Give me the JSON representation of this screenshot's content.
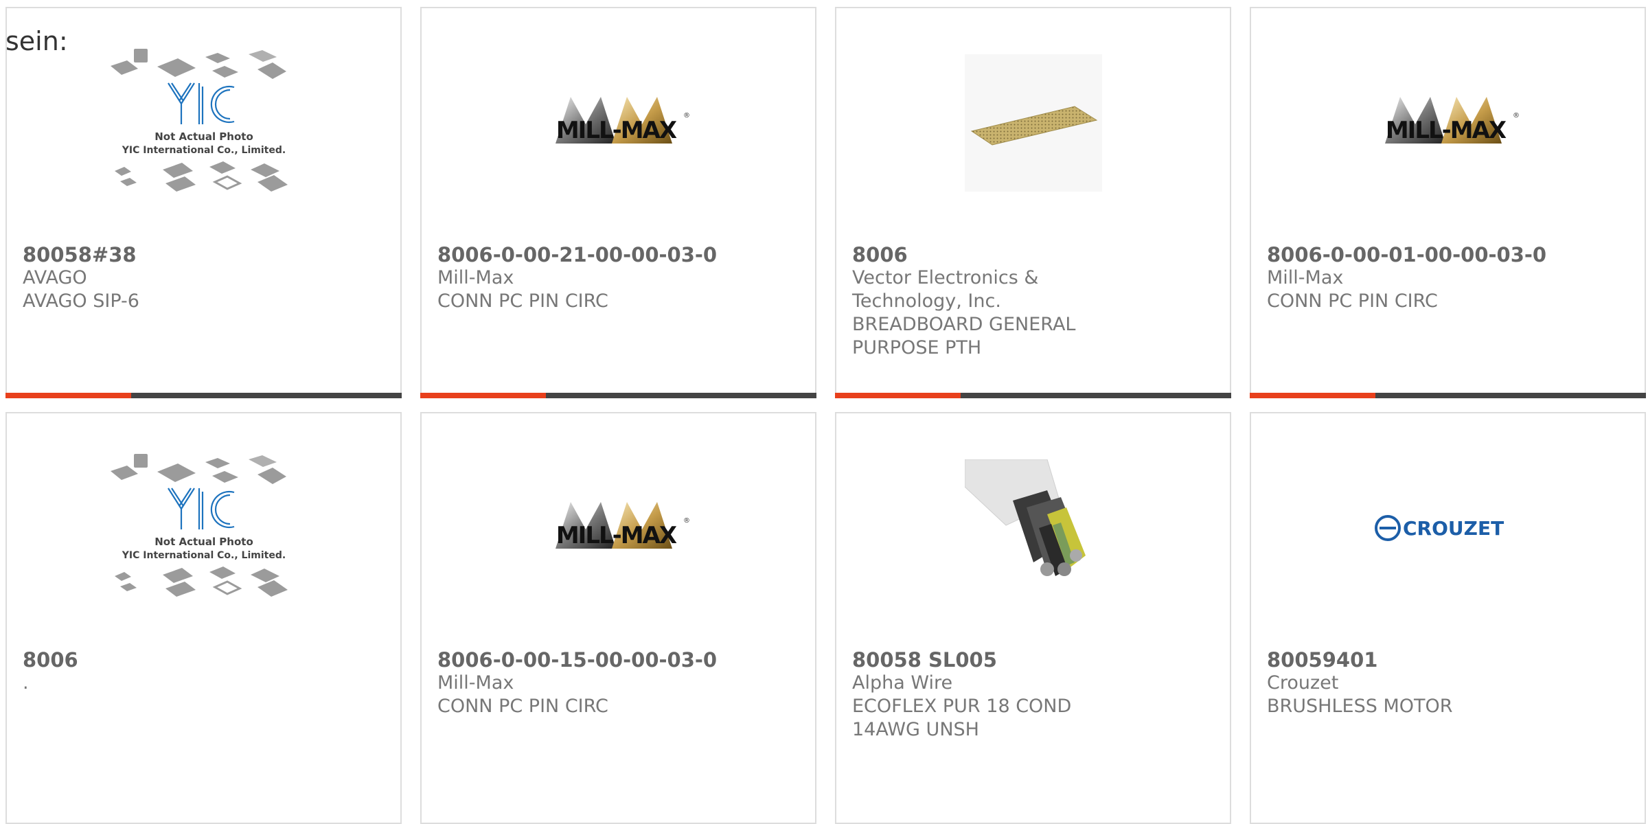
{
  "lead_text": "sein:",
  "colors": {
    "accent_bar": "#e8401c",
    "bar": "#444444",
    "border": "#dddddd",
    "yic_blue": "#1d73be",
    "crouzet_blue": "#1c5ea8"
  },
  "products": [
    {
      "part_number": "80058#38",
      "manufacturer": "AVAGO",
      "description": "AVAGO SIP-6",
      "image": "yic-placeholder",
      "yic_caption_1": "Not Actual Photo",
      "yic_caption_2": "YIC International Co., Limited."
    },
    {
      "part_number": "8006-0-00-21-00-00-03-0",
      "manufacturer": "Mill-Max",
      "description": "CONN PC PIN CIRC",
      "image": "mill-max-logo",
      "logo_text": "MILL-MAX"
    },
    {
      "part_number": "8006",
      "manufacturer": "Vector Electronics & Technology, Inc.",
      "description": "BREADBOARD GENERAL PURPOSE PTH",
      "image": "breadboard-photo"
    },
    {
      "part_number": "8006-0-00-01-00-00-03-0",
      "manufacturer": "Mill-Max",
      "description": "CONN PC PIN CIRC",
      "image": "mill-max-logo",
      "logo_text": "MILL-MAX"
    },
    {
      "part_number": "8006",
      "manufacturer": ".",
      "description": "",
      "image": "yic-placeholder",
      "yic_caption_1": "Not Actual Photo",
      "yic_caption_2": "YIC International Co., Limited."
    },
    {
      "part_number": "8006-0-00-15-00-00-03-0",
      "manufacturer": "Mill-Max",
      "description": "CONN PC PIN CIRC",
      "image": "mill-max-logo",
      "logo_text": "MILL-MAX"
    },
    {
      "part_number": "80058 SL005",
      "manufacturer": "Alpha Wire",
      "description": "ECOFLEX PUR 18 COND 14AWG UNSH",
      "image": "cable-photo"
    },
    {
      "part_number": "80059401",
      "manufacturer": "Crouzet",
      "description": "BRUSHLESS MOTOR",
      "image": "crouzet-logo",
      "logo_text": "CROUZET"
    }
  ]
}
